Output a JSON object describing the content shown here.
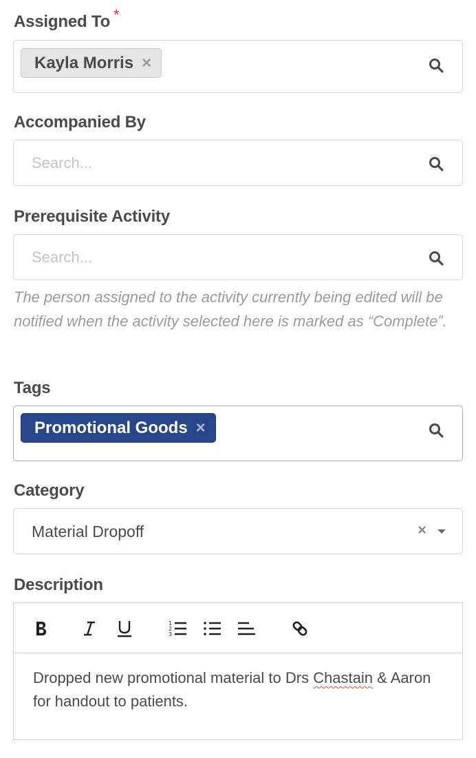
{
  "assigned_to": {
    "label": "Assigned To",
    "required_marker": "*",
    "chips": [
      {
        "label": "Kayla Morris",
        "remove": "×"
      }
    ]
  },
  "accompanied_by": {
    "label": "Accompanied By",
    "placeholder": "Search..."
  },
  "prerequisite_activity": {
    "label": "Prerequisite Activity",
    "placeholder": "Search...",
    "help_text": "The person assigned to the activity currently being edited will be notified when the activity selected here is marked as “Complete”."
  },
  "tags": {
    "label": "Tags",
    "chips": [
      {
        "label": "Promotional Goods",
        "remove": "×"
      }
    ]
  },
  "category": {
    "label": "Category",
    "value": "Material Dropoff",
    "clear": "×"
  },
  "description": {
    "label": "Description",
    "toolbar": [
      "bold-icon",
      "italic-icon",
      "underline-icon",
      "ordered-list-icon",
      "bullet-list-icon",
      "align-left-icon",
      "link-icon"
    ],
    "text_before": "Dropped new promotional material to Drs ",
    "text_misspelled": "Chastain",
    "text_after": " & Aaron for handout to patients."
  },
  "colors": {
    "tag_chip": "#27478a",
    "required": "#d0312d",
    "person_chip": "#e6e6e6"
  }
}
